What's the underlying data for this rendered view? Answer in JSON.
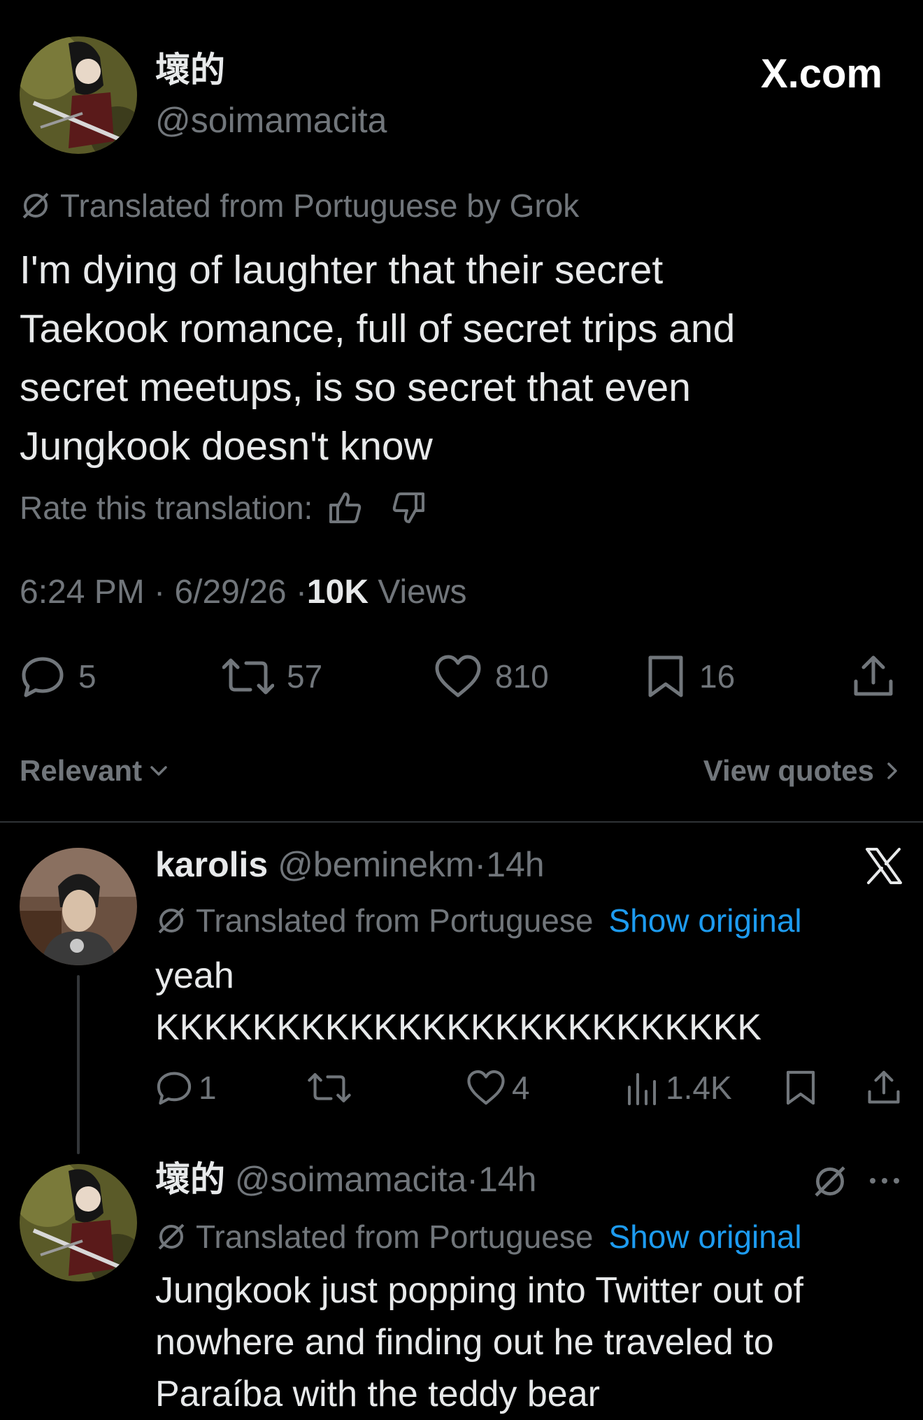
{
  "main_tweet": {
    "display_name": "壞的",
    "handle": "@soimamacita",
    "site_label": "X.com",
    "translated_note": "Translated from Portuguese by Grok",
    "body_lines": [
      "I'm dying of laughter that their secret",
      "Taekook romance, full of secret trips and",
      "secret meetups, is so secret that even",
      "Jungkook doesn't know"
    ],
    "rate_label": "Rate this translation:",
    "time": "6:24 PM",
    "date": "6/29/26",
    "views_count": "10K",
    "views_label": "Views",
    "replies": "5",
    "reposts": "57",
    "likes": "810",
    "bookmarks": "16"
  },
  "sort": {
    "relevant_label": "Relevant",
    "view_quotes_label": "View quotes"
  },
  "reply1": {
    "display_name": "karolis",
    "handle": "@beminekm",
    "time": "14h",
    "translated_note": "Translated from Portuguese",
    "show_original": "Show original",
    "body_lines": [
      "yeah",
      "KKKKKKKKKKKKKKKKKKKKKKKKK"
    ],
    "replies": "1",
    "likes": "4",
    "views": "1.4K"
  },
  "reply2": {
    "display_name": "壞的",
    "handle": "@soimamacita",
    "time": "14h",
    "translated_note": "Translated from Portuguese",
    "show_original": "Show original",
    "body_lines": [
      "Jungkook just popping into Twitter out of",
      "nowhere and finding out he traveled to",
      "Paraíba with the teddy bear"
    ]
  },
  "separator": "·",
  "colors": {
    "background": "#000000",
    "text_primary": "#e7e9ea",
    "text_secondary": "#71767b",
    "link": "#1d9bf0",
    "divider": "#2f3336"
  }
}
